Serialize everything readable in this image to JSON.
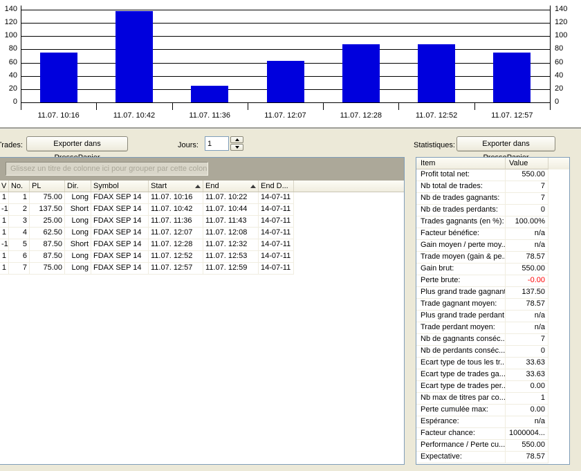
{
  "chart_data": {
    "type": "bar",
    "categories": [
      "11.07. 10:16",
      "11.07. 10:42",
      "11.07. 11:36",
      "11.07. 12:07",
      "11.07. 12:28",
      "11.07. 12:52",
      "11.07. 12:57"
    ],
    "values": [
      75,
      137.5,
      25,
      62.5,
      87.5,
      87.5,
      75
    ],
    "title": "",
    "xlabel": "",
    "ylabel": "",
    "ylim": [
      0,
      140
    ],
    "ytick_step": 20,
    "bar_color": "#0000DD",
    "grid": true,
    "axis_label_sides": [
      "left",
      "right"
    ]
  },
  "toolbar": {
    "trades_label": "Trades:",
    "export_button": "Exporter dans PressePapier",
    "jours_label": "Jours:",
    "jours_value": "1"
  },
  "trades_grid": {
    "group_hint": "Glissez un titre de colonne ici pour grouper par cette colonne.",
    "columns": [
      "V",
      "No.",
      "PL",
      "Dir.",
      "Symbol",
      "Start",
      "End",
      "End D..."
    ],
    "sorted_columns": [
      "Start",
      "End"
    ],
    "rows": [
      [
        "1",
        "1",
        "75.00",
        "Long",
        "FDAX SEP 14",
        "11.07. 10:16",
        "11.07. 10:22",
        "14-07-11"
      ],
      [
        "-1",
        "2",
        "137.50",
        "Short",
        "FDAX SEP 14",
        "11.07. 10:42",
        "11.07. 10:44",
        "14-07-11"
      ],
      [
        "1",
        "3",
        "25.00",
        "Long",
        "FDAX SEP 14",
        "11.07. 11:36",
        "11.07. 11:43",
        "14-07-11"
      ],
      [
        "1",
        "4",
        "62.50",
        "Long",
        "FDAX SEP 14",
        "11.07. 12:07",
        "11.07. 12:08",
        "14-07-11"
      ],
      [
        "-1",
        "5",
        "87.50",
        "Short",
        "FDAX SEP 14",
        "11.07. 12:28",
        "11.07. 12:32",
        "14-07-11"
      ],
      [
        "1",
        "6",
        "87.50",
        "Long",
        "FDAX SEP 14",
        "11.07. 12:52",
        "11.07. 12:53",
        "14-07-11"
      ],
      [
        "1",
        "7",
        "75.00",
        "Long",
        "FDAX SEP 14",
        "11.07. 12:57",
        "11.07. 12:59",
        "14-07-11"
      ]
    ]
  },
  "statistics": {
    "label": "Statistiques:",
    "export_button": "Exporter dans PressePapier",
    "columns": [
      "Item",
      "Value"
    ],
    "rows": [
      {
        "item": "Profit total net:",
        "value": "550.00"
      },
      {
        "item": "Nb total de trades:",
        "value": "7"
      },
      {
        "item": "Nb de trades gagnants:",
        "value": "7"
      },
      {
        "item": "Nb de trades perdants:",
        "value": "0"
      },
      {
        "item": "Trades gagnants (en %):",
        "value": "100.00%"
      },
      {
        "item": "Facteur bénéfice:",
        "value": "n/a"
      },
      {
        "item": "Gain moyen / perte moy...",
        "value": "n/a"
      },
      {
        "item": "Trade moyen (gain & pe...",
        "value": "78.57"
      },
      {
        "item": "Gain brut:",
        "value": "550.00"
      },
      {
        "item": "Perte brute:",
        "value": "-0.00",
        "value_color": "#FF0000"
      },
      {
        "item": "Plus grand trade gagnant:",
        "value": "137.50"
      },
      {
        "item": "Trade gagnant moyen:",
        "value": "78.57"
      },
      {
        "item": "Plus grand trade perdant:",
        "value": "n/a"
      },
      {
        "item": "Trade perdant moyen:",
        "value": "n/a"
      },
      {
        "item": "Nb de gagnants conséc...",
        "value": "7"
      },
      {
        "item": "Nb de perdants conséc...",
        "value": "0"
      },
      {
        "item": "Ecart type de tous les tr...",
        "value": "33.63"
      },
      {
        "item": "Ecart type de trades ga...",
        "value": "33.63"
      },
      {
        "item": "Ecart type de trades per...",
        "value": "0.00"
      },
      {
        "item": "Nb max de titres par co...",
        "value": "1"
      },
      {
        "item": "Perte cumulée max:",
        "value": "0.00"
      },
      {
        "item": "Espérance:",
        "value": "n/a"
      },
      {
        "item": "Facteur chance:",
        "value": "1000004..."
      },
      {
        "item": "Performance / Perte cu...",
        "value": "550.00"
      },
      {
        "item": "Expectative:",
        "value": "78.57"
      }
    ]
  },
  "colors": {
    "bar": "#0000DD",
    "negative_value": "#FF0000",
    "panel_background": "#ECE9D8",
    "control_border": "#7F9DB9"
  }
}
